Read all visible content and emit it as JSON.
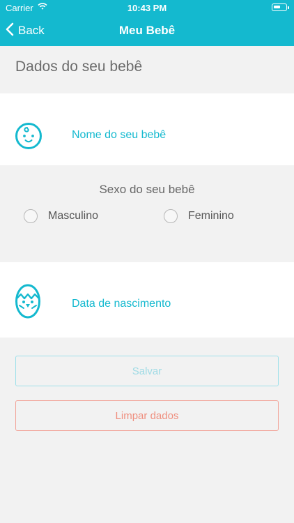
{
  "status_bar": {
    "carrier": "Carrier",
    "time": "10:43 PM",
    "wifi_icon": "wifi-icon",
    "battery_icon": "battery-icon"
  },
  "nav": {
    "back_label": "Back",
    "title": "Meu Bebê"
  },
  "section_title": "Dados do seu bebê",
  "name_card": {
    "icon": "baby-face-icon",
    "label": "Nome do seu bebê"
  },
  "sex": {
    "title": "Sexo do seu bebê",
    "options": [
      "Masculino",
      "Feminino"
    ]
  },
  "date_card": {
    "icon": "hatching-egg-icon",
    "label": "Data de nascimento"
  },
  "buttons": {
    "save": "Salvar",
    "clear": "Limpar dados"
  },
  "colors": {
    "accent": "#14b9cf",
    "background": "#f2f2f2",
    "save_border": "#9fe0ea",
    "clear_border": "#f2a59a"
  }
}
